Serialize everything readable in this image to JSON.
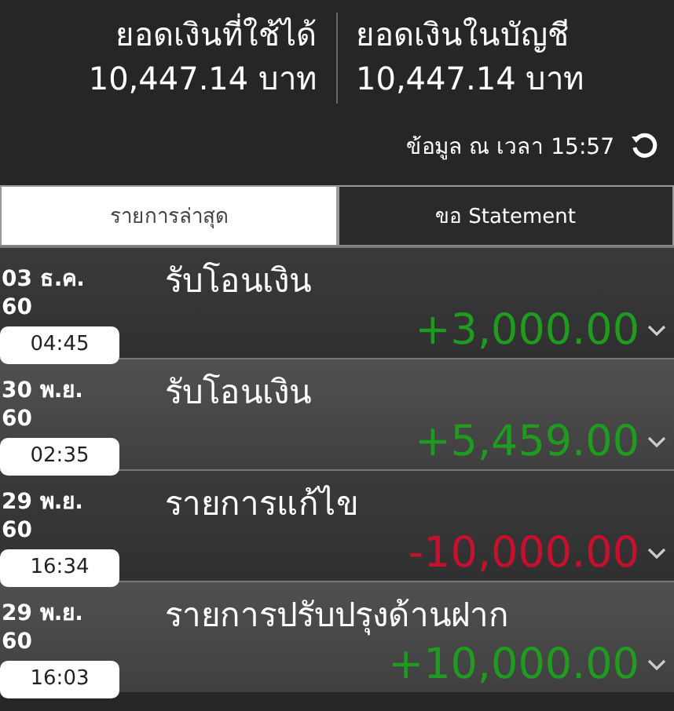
{
  "balances": [
    {
      "label": "ยอดเงินที่ใช้ได้",
      "amount": "10,447.14 บาท"
    },
    {
      "label": "ยอดเงินในบัญชี",
      "amount": "10,447.14 บาท"
    }
  ],
  "updated": "ข้อมูล ณ เวลา 15:57",
  "tabs": [
    {
      "label": "รายการล่าสุด",
      "selected": true
    },
    {
      "label": "ขอ Statement",
      "selected": false
    }
  ],
  "transactions": [
    {
      "date": "03 ธ.ค. 60",
      "time": "04:45",
      "title": "รับโอนเงิน",
      "amount": "+3,000.00",
      "kind": "credit"
    },
    {
      "date": "30 พ.ย. 60",
      "time": "02:35",
      "title": "รับโอนเงิน",
      "amount": "+5,459.00",
      "kind": "credit"
    },
    {
      "date": "29 พ.ย. 60",
      "time": "16:34",
      "title": "รายการแก้ไข",
      "amount": "-10,000.00",
      "kind": "debit"
    },
    {
      "date": "29 พ.ย. 60",
      "time": "16:03",
      "title": "รายการปรับปรุงด้านฝาก",
      "amount": "+10,000.00",
      "kind": "credit"
    }
  ]
}
